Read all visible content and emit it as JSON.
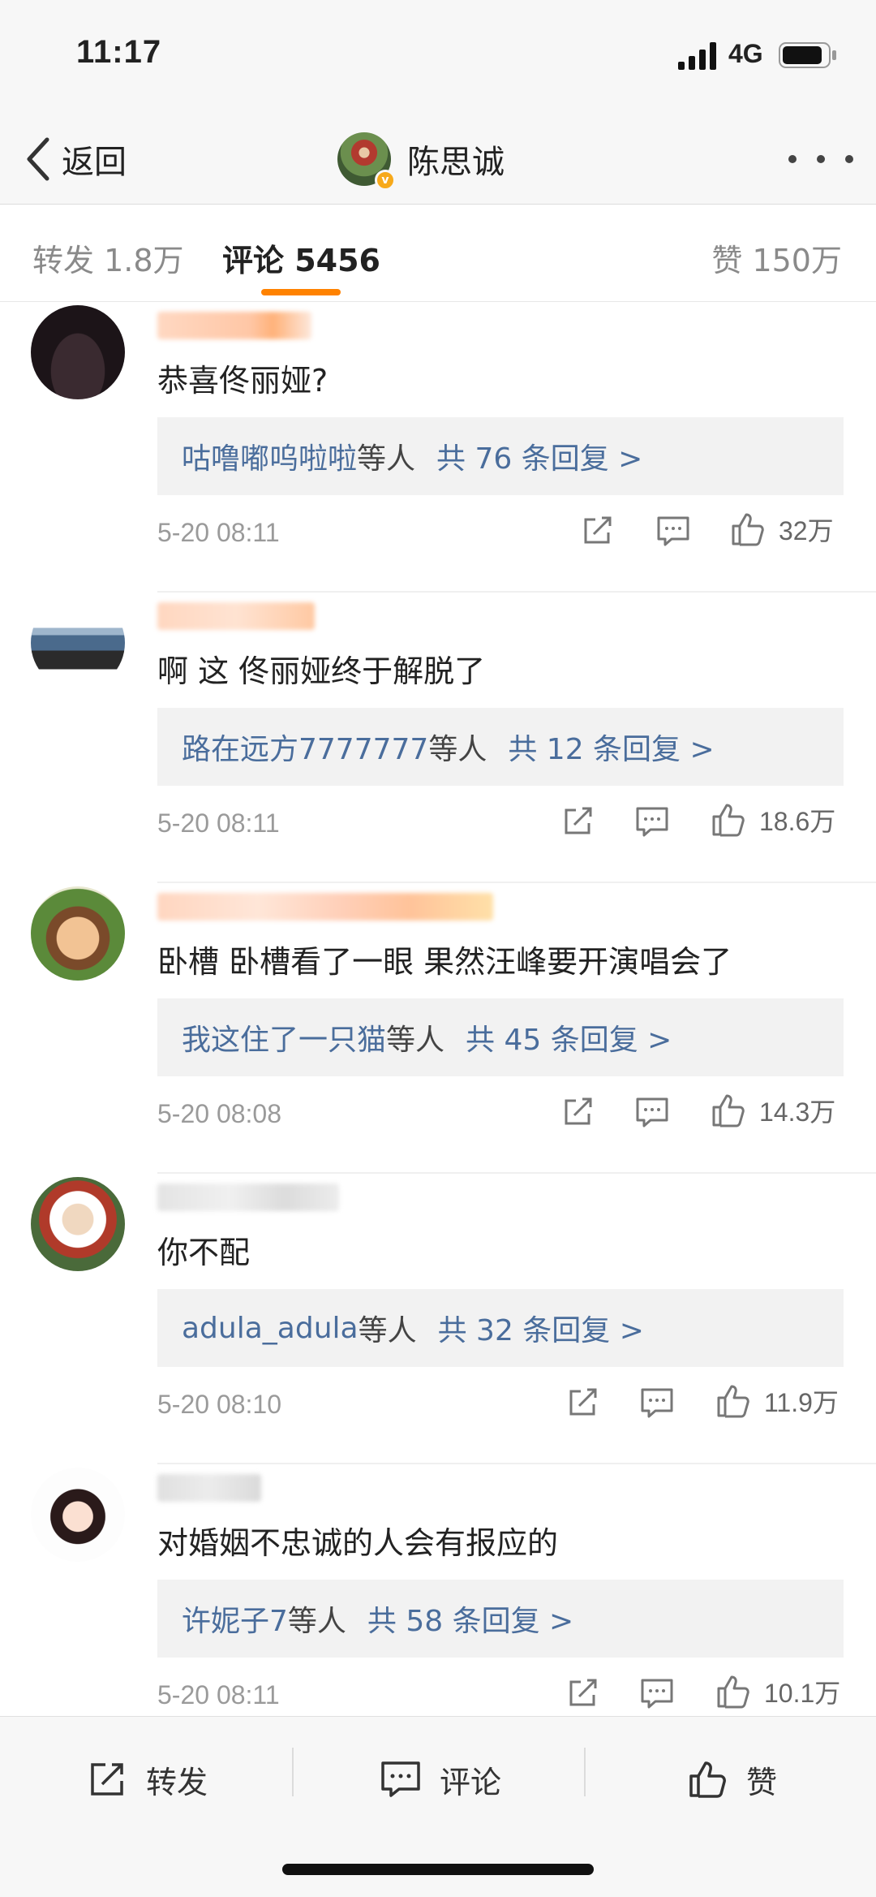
{
  "status": {
    "time": "11:17",
    "network": "4G"
  },
  "nav": {
    "back_label": "返回",
    "user_name": "陈思诚"
  },
  "tabs": {
    "repost": "转发 1.8万",
    "comments": "评论 5456",
    "likes": "赞 150万"
  },
  "comments": [
    {
      "text": "恭喜佟丽娅?",
      "reply_user": "咕噜嘟呜啦啦",
      "reply_mid": "等人",
      "reply_count": "共 76 条回复 >",
      "time": "5-20 08:11",
      "likes": "32万"
    },
    {
      "text": "啊 这  佟丽娅终于解脱了",
      "reply_user": "路在远方7777777",
      "reply_mid": "等人",
      "reply_count": "共 12 条回复 >",
      "time": "5-20 08:11",
      "likes": "18.6万"
    },
    {
      "text": "卧槽 卧槽看了一眼 果然汪峰要开演唱会了",
      "reply_user": "我这住了一只猫",
      "reply_mid": "等人",
      "reply_count": "共 45 条回复 >",
      "time": "5-20 08:08",
      "likes": "14.3万"
    },
    {
      "text": "你不配",
      "reply_user": "adula_adula",
      "reply_mid": "等人",
      "reply_count": "共 32 条回复 >",
      "time": "5-20 08:10",
      "likes": "11.9万"
    },
    {
      "text": "对婚姻不忠诚的人会有报应的",
      "reply_user": "许妮子7",
      "reply_mid": "等人",
      "reply_count": "共 58 条回复 >",
      "time": "5-20 08:11",
      "likes": "10.1万"
    }
  ],
  "toolbar": {
    "repost": "转发",
    "comment": "评论",
    "like": "赞"
  },
  "colors": {
    "accent": "#ff8200",
    "link": "#4a6d9c",
    "verified": "#f7a91a"
  }
}
